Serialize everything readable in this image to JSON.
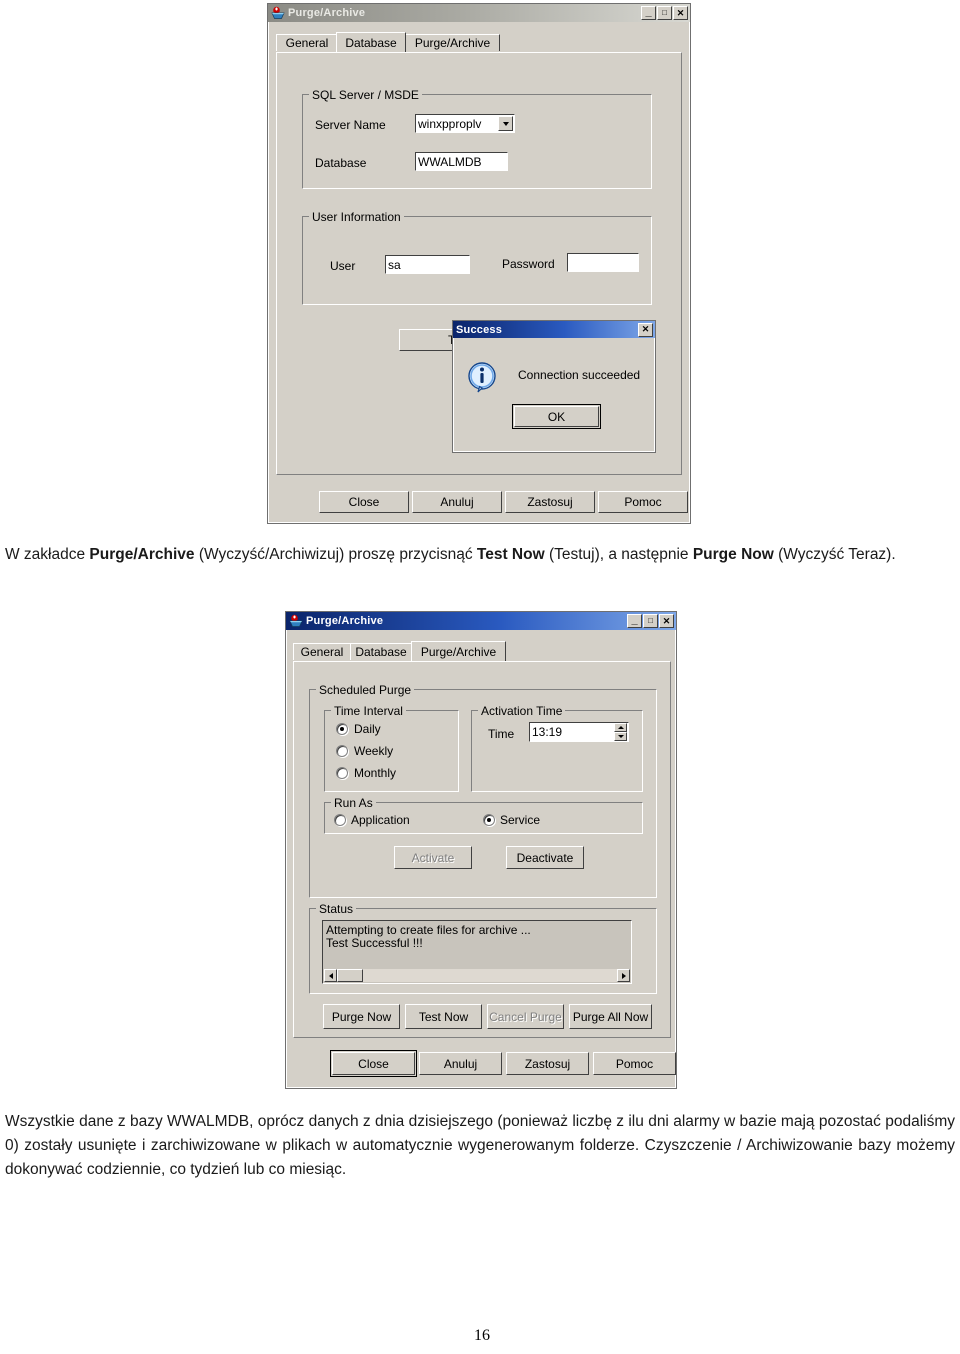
{
  "page": {
    "number": "16"
  },
  "paragraph_top": {
    "runs": [
      {
        "t": "W zakładce ",
        "b": false
      },
      {
        "t": "Purge/Archive",
        "b": true
      },
      {
        "t": " (Wyczyść/Archiwizuj) proszę przycisnąć ",
        "b": false
      },
      {
        "t": "Test Now",
        "b": true
      },
      {
        "t": " (Testuj), a następnie ",
        "b": false
      },
      {
        "t": "Purge Now",
        "b": true
      },
      {
        "t": " (Wyczyść Teraz).",
        "b": false
      }
    ]
  },
  "paragraph_bottom": {
    "runs": [
      {
        "t": "Wszystkie dane z bazy WWALMDB, oprócz danych z dnia dzisiejszego (ponieważ liczbę z ilu dni alarmy w bazie mają pozostać podaliśmy 0) zostały usunięte i zarchiwizowane w plikach w automatycznie wygenerowanym folderze. Czyszczenie / Archiwizowanie bazy możemy dokonywać codziennie, co tydzień lub co miesiąc.",
        "b": false
      }
    ]
  },
  "dialog_database": {
    "title": "Purge/Archive",
    "titlebar_state": "inactive",
    "titlebar_buttons": {
      "minimize": "_",
      "maximize": "□",
      "close": "✕"
    },
    "tabs": [
      {
        "label": "General",
        "selected": false
      },
      {
        "label": "Database",
        "selected": true
      },
      {
        "label": "Purge/Archive",
        "selected": false
      }
    ],
    "group_sql": {
      "legend": "SQL Server / MSDE",
      "server_name_label": "Server Name",
      "server_name_value": "winxpproplv",
      "database_label": "Database",
      "database_value": "WWALMDB"
    },
    "group_user": {
      "legend": "User Information",
      "user_label": "User",
      "user_value": "sa",
      "password_label": "Password",
      "password_value": ""
    },
    "test_button": "Test",
    "footer_buttons": [
      "Close",
      "Anuluj",
      "Zastosuj",
      "Pomoc"
    ]
  },
  "dialog_success": {
    "title": "Success",
    "titlebar_state": "active",
    "close_label": "✕",
    "icon": "info-icon",
    "message": "Connection succeeded",
    "ok_button": "OK"
  },
  "dialog_purge": {
    "title": "Purge/Archive",
    "titlebar_state": "active",
    "titlebar_buttons": {
      "minimize": "_",
      "maximize": "□",
      "close": "✕"
    },
    "tabs": [
      {
        "label": "General",
        "selected": false
      },
      {
        "label": "Database",
        "selected": false
      },
      {
        "label": "Purge/Archive",
        "selected": true
      }
    ],
    "group_scheduled": {
      "legend": "Scheduled Purge",
      "group_interval": {
        "legend": "Time Interval",
        "options": [
          {
            "label": "Daily",
            "selected": true
          },
          {
            "label": "Weekly",
            "selected": false
          },
          {
            "label": "Monthly",
            "selected": false
          }
        ]
      },
      "group_activation": {
        "legend": "Activation Time",
        "time_label": "Time",
        "time_value": "13:19"
      },
      "group_runas": {
        "legend": "Run As",
        "options": [
          {
            "label": "Application",
            "selected": false
          },
          {
            "label": "Service",
            "selected": true
          }
        ]
      },
      "activate_button": {
        "label": "Activate",
        "disabled": true
      },
      "deactivate_button": {
        "label": "Deactivate",
        "disabled": false
      }
    },
    "group_status": {
      "legend": "Status",
      "lines": [
        "Attempting to create files for archive ...",
        "Test Successful !!!"
      ]
    },
    "action_buttons": [
      {
        "label": "Purge Now",
        "disabled": false
      },
      {
        "label": "Test Now",
        "disabled": false
      },
      {
        "label": "Cancel Purge",
        "disabled": true
      },
      {
        "label": "Purge All Now",
        "disabled": false
      }
    ],
    "footer_buttons": [
      "Close",
      "Anuluj",
      "Zastosuj",
      "Pomoc"
    ]
  },
  "colors": {
    "face": "#d4d0c8",
    "titlebar_active_start": "#0a246a",
    "titlebar_active_end": "#7ea7e8",
    "titlebar_inactive": "#a9a9a2",
    "listbox_bg": "#c8c4bc"
  }
}
